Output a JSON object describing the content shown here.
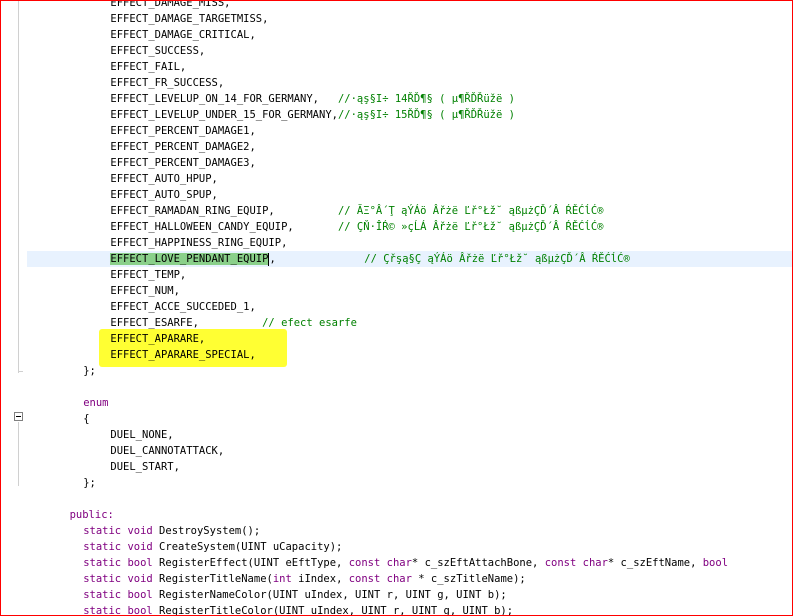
{
  "editor": {
    "lines": [
      {
        "indent": 8,
        "text": "EFFECT_DAMAGE_MISS,",
        "comment": ""
      },
      {
        "indent": 8,
        "text": "EFFECT_DAMAGE_TARGETMISS,",
        "comment": ""
      },
      {
        "indent": 8,
        "text": "EFFECT_DAMAGE_CRITICAL,",
        "comment": ""
      },
      {
        "indent": 8,
        "text": "EFFECT_SUCCESS,",
        "comment": ""
      },
      {
        "indent": 8,
        "text": "EFFECT_FAIL,",
        "comment": ""
      },
      {
        "indent": 8,
        "text": "EFFECT_FR_SUCCESS,",
        "comment": ""
      },
      {
        "indent": 8,
        "text": "EFFECT_LEVELUP_ON_14_FOR_GERMANY,   ",
        "comment": "//·ąş§I÷ 14ŘĎ¶§ ( µ¶ŘĎŘüžë )"
      },
      {
        "indent": 8,
        "text": "EFFECT_LEVELUP_UNDER_15_FOR_GERMANY,",
        "comment": "//·ąş§I÷ 15ŘĎ¶§ ( µ¶ŘĎŘüžë )"
      },
      {
        "indent": 8,
        "text": "EFFECT_PERCENT_DAMAGE1,",
        "comment": ""
      },
      {
        "indent": 8,
        "text": "EFFECT_PERCENT_DAMAGE2,",
        "comment": ""
      },
      {
        "indent": 8,
        "text": "EFFECT_PERCENT_DAMAGE3,",
        "comment": ""
      },
      {
        "indent": 8,
        "text": "EFFECT_AUTO_HPUP,",
        "comment": ""
      },
      {
        "indent": 8,
        "text": "EFFECT_AUTO_SPUP,",
        "comment": ""
      },
      {
        "indent": 8,
        "text": "EFFECT_RAMADAN_RING_EQUIP,          ",
        "comment": "// ĂΞ°Â´Ţ ąÝÁö Âřżë Ľř°Łž˘ ąßµżÇĎ´Â ŔĚĆĺĆ®"
      },
      {
        "indent": 8,
        "text": "EFFECT_HALLOWEEN_CANDY_EQUIP,       ",
        "comment": "// ÇŇ·ÎŔ© »çĹÁ Âřżë Ľř°Łž˘ ąßµżÇĎ´Â ŔĚĆĺĆ®"
      },
      {
        "indent": 8,
        "text": "EFFECT_HAPPINESS_RING_EQUIP,",
        "comment": ""
      },
      {
        "indent": 8,
        "text": "EFFECT_LOVE_PENDANT_EQUIP",
        "tail": ",              ",
        "comment": "// Çřşą§Ç ąÝÁö Âřżë Ľř°Łž˘ ąßµżÇĎ´Â ŔĚĆĺĆ®",
        "current": true
      },
      {
        "indent": 8,
        "text": "EFFECT_TEMP,",
        "comment": ""
      },
      {
        "indent": 8,
        "text": "EFFECT_NUM,",
        "comment": ""
      },
      {
        "indent": 8,
        "text": "EFFECT_ACCE_SUCCEDED_1,",
        "comment": ""
      },
      {
        "indent": 8,
        "text": "EFFECT_ESARFE,          ",
        "comment": "// efect esarfe"
      },
      {
        "indent": 8,
        "text": "EFFECT_APARARE,",
        "comment": "",
        "yellow": true
      },
      {
        "indent": 8,
        "text": "EFFECT_APARARE_SPECIAL,",
        "comment": "",
        "yellow": true
      },
      {
        "indent": 4,
        "text": "};",
        "comment": ""
      },
      {
        "indent": 0,
        "text": "",
        "comment": ""
      },
      {
        "indent": 4,
        "kw": "enum",
        "text": "",
        "comment": ""
      },
      {
        "indent": 4,
        "text": "{",
        "comment": ""
      },
      {
        "indent": 8,
        "text": "DUEL_NONE,",
        "comment": ""
      },
      {
        "indent": 8,
        "text": "DUEL_CANNOTATTACK,",
        "comment": ""
      },
      {
        "indent": 8,
        "text": "DUEL_START,",
        "comment": ""
      },
      {
        "indent": 4,
        "text": "};",
        "comment": ""
      },
      {
        "indent": 0,
        "text": "",
        "comment": ""
      },
      {
        "indent": 2,
        "kw": "public:",
        "text": "",
        "comment": ""
      },
      {
        "indent": 4,
        "segments": [
          [
            "kw",
            "static void "
          ],
          [
            "",
            "DestroySystem();"
          ]
        ]
      },
      {
        "indent": 4,
        "segments": [
          [
            "kw",
            "static void "
          ],
          [
            "",
            "CreateSystem(UINT uCapacity);"
          ]
        ]
      },
      {
        "indent": 4,
        "segments": [
          [
            "kw",
            "static bool "
          ],
          [
            "",
            "RegisterEffect(UINT eEftType, "
          ],
          [
            "kw",
            "const char"
          ],
          [
            "",
            "* c_szEftAttachBone, "
          ],
          [
            "kw",
            "const char"
          ],
          [
            "",
            "* c_szEftName, "
          ],
          [
            "kw",
            "bool"
          ]
        ]
      },
      {
        "indent": 4,
        "segments": [
          [
            "kw",
            "static void "
          ],
          [
            "",
            "RegisterTitleName("
          ],
          [
            "kw",
            "int"
          ],
          [
            "",
            " iIndex, "
          ],
          [
            "kw",
            "const char"
          ],
          [
            "",
            " * c_szTitleName);"
          ]
        ]
      },
      {
        "indent": 4,
        "segments": [
          [
            "kw",
            "static bool "
          ],
          [
            "",
            "RegisterNameColor(UINT uIndex, UINT r, UINT g, UINT b);"
          ]
        ]
      },
      {
        "indent": 4,
        "segments": [
          [
            "kw",
            "static bool "
          ],
          [
            "",
            "RegisterTitleColor(UINT uIndex, UINT r, UINT g, UINT b);"
          ]
        ]
      }
    ]
  }
}
